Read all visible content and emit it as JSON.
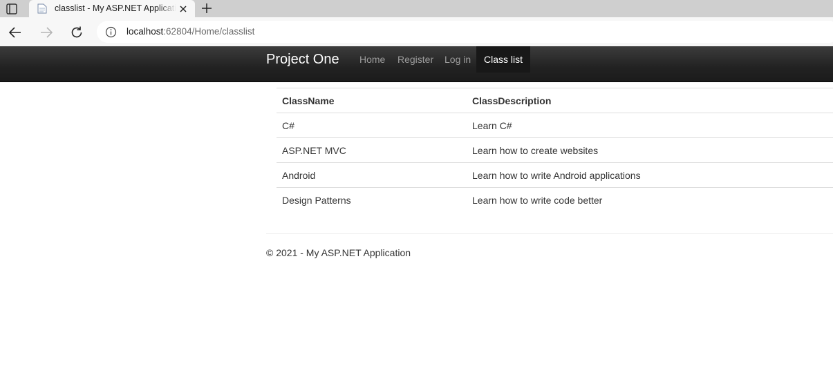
{
  "browser": {
    "tab": {
      "title": "classlist - My ASP.NET Application",
      "favicon": "page-icon",
      "close_icon": "close-icon"
    },
    "new_tab_icon": "plus-icon",
    "tab_actions_icon": "tab-actions-icon",
    "nav": {
      "back_icon": "back-arrow-icon",
      "forward_icon": "forward-arrow-icon",
      "reload_icon": "reload-icon"
    },
    "address": {
      "info_icon": "info-icon",
      "host": "localhost",
      "rest": ":62804/Home/classlist"
    }
  },
  "site": {
    "brand": "Project One",
    "nav": [
      {
        "label": "Home"
      },
      {
        "label": "Register"
      },
      {
        "label": "Log in"
      },
      {
        "label": "Class list",
        "active": true
      }
    ]
  },
  "table": {
    "headers": [
      "ClassName",
      "ClassDescription"
    ],
    "rows": [
      [
        "C#",
        "Learn C#"
      ],
      [
        "ASP.NET MVC",
        "Learn how to create websites"
      ],
      [
        "Android",
        "Learn how to write Android applications"
      ],
      [
        "Design Patterns",
        "Learn how to write code better"
      ]
    ]
  },
  "footer": {
    "text": "© 2021 - My ASP.NET Application"
  },
  "colors": {
    "navbar": "#222222",
    "nav_text": "#9d9d9d",
    "nav_active": "#ffffff",
    "body_text": "#333333"
  }
}
